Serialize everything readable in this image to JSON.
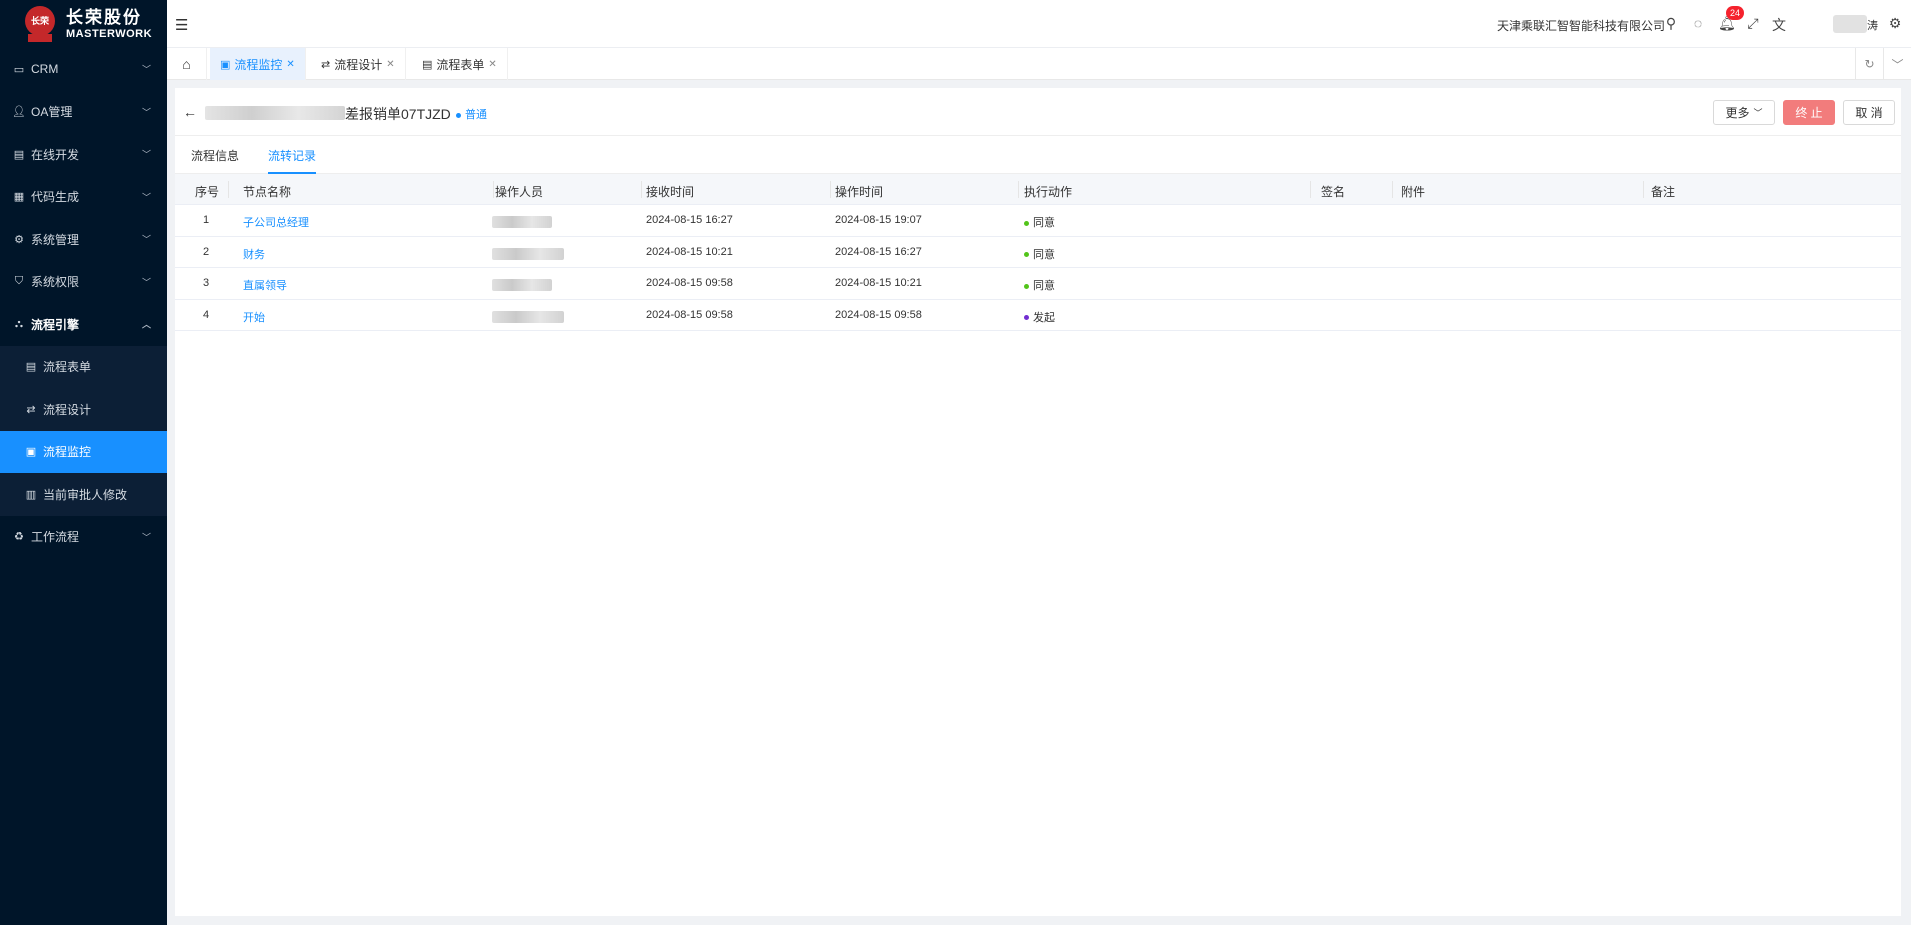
{
  "sidebar": {
    "logo": {
      "cn": "长荣股份",
      "en": "MASTERWORK",
      "mark": "长荣"
    },
    "items": [
      {
        "label": "CRM",
        "icon": "laptop-icon"
      },
      {
        "label": "OA管理",
        "icon": "user-icon"
      },
      {
        "label": "在线开发",
        "icon": "dev-icon"
      },
      {
        "label": "代码生成",
        "icon": "code-icon"
      },
      {
        "label": "系统管理",
        "icon": "gear-icon"
      },
      {
        "label": "系统权限",
        "icon": "shield-icon"
      },
      {
        "label": "流程引擎",
        "icon": "flow-icon"
      }
    ],
    "sub_items": [
      {
        "label": "流程表单",
        "icon": "table-icon"
      },
      {
        "label": "流程设计",
        "icon": "swap-icon"
      },
      {
        "label": "流程监控",
        "icon": "monitor-icon"
      },
      {
        "label": "当前审批人修改",
        "icon": "doc-icon"
      }
    ],
    "last_item": {
      "label": "工作流程",
      "icon": "recycle-icon"
    }
  },
  "header": {
    "company": "天津乘联汇智智能科技有限公司",
    "notification_count": "24",
    "user_char": "涛"
  },
  "tabs": [
    {
      "label": "流程监控",
      "icon": "monitor-icon"
    },
    {
      "label": "流程设计",
      "icon": "swap-icon"
    },
    {
      "label": "流程表单",
      "icon": "table-icon"
    }
  ],
  "page": {
    "title": "差报销单07TJZD",
    "priority": "普通",
    "buttons": {
      "more": "更多",
      "stop": "终 止",
      "cancel": "取 消"
    },
    "subtabs": [
      "流程信息",
      "流转记录"
    ]
  },
  "table": {
    "columns": [
      "序号",
      "节点名称",
      "操作人员",
      "接收时间",
      "操作时间",
      "执行动作",
      "签名",
      "附件",
      "备注"
    ],
    "rows": [
      {
        "no": "1",
        "node": "子公司总经理",
        "received": "2024-08-15 16:27",
        "operated": "2024-08-15 19:07",
        "action": "同意",
        "action_color": "#52c41a"
      },
      {
        "no": "2",
        "node": "财务",
        "received": "2024-08-15 10:21",
        "operated": "2024-08-15 16:27",
        "action": "同意",
        "action_color": "#52c41a"
      },
      {
        "no": "3",
        "node": "直属领导",
        "received": "2024-08-15 09:58",
        "operated": "2024-08-15 10:21",
        "action": "同意",
        "action_color": "#52c41a"
      },
      {
        "no": "4",
        "node": "开始",
        "received": "2024-08-15 09:58",
        "operated": "2024-08-15 09:58",
        "action": "发起",
        "action_color": "#722ed1"
      }
    ]
  }
}
